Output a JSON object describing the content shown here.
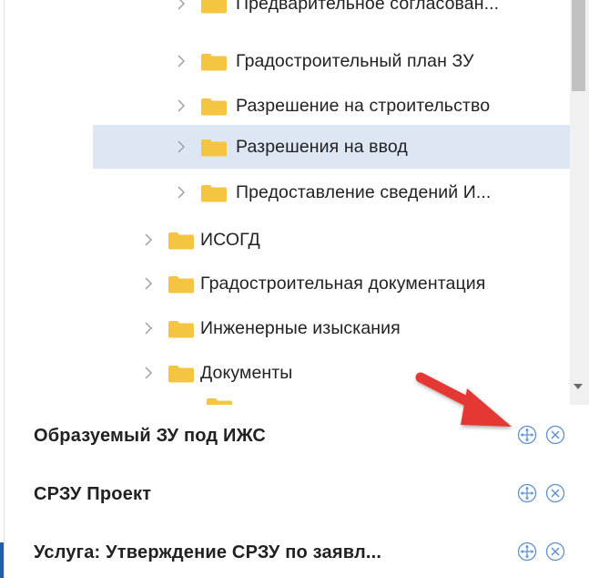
{
  "tree": {
    "items": [
      {
        "label": "Предварительное согласован..."
      },
      {
        "label": "Градостроительный план ЗУ"
      },
      {
        "label": "Разрешение на строительство"
      },
      {
        "label": "Разрешения на ввод"
      },
      {
        "label": "Предоставление сведений И..."
      },
      {
        "label": "ИСОГД"
      },
      {
        "label": "Градостроительная документация"
      },
      {
        "label": "Инженерные изыскания"
      },
      {
        "label": "Документы"
      }
    ],
    "selected_index": 3
  },
  "layers": [
    {
      "title": "Образуемый ЗУ под ИЖС"
    },
    {
      "title": "СРЗУ Проект"
    },
    {
      "title": "Услуга: Утверждение СРЗУ по заявл..."
    }
  ],
  "icons": {
    "folder": "folder-icon",
    "chevron": "chevron-right-icon",
    "move": "move-icon",
    "close": "close-circle-icon",
    "pointer": "red-arrow-icon"
  },
  "colors": {
    "folder": "#f5c542",
    "selected_row": "#dde7f4",
    "icon_blue": "#5a8fd0",
    "arrow_red": "#e53935"
  }
}
